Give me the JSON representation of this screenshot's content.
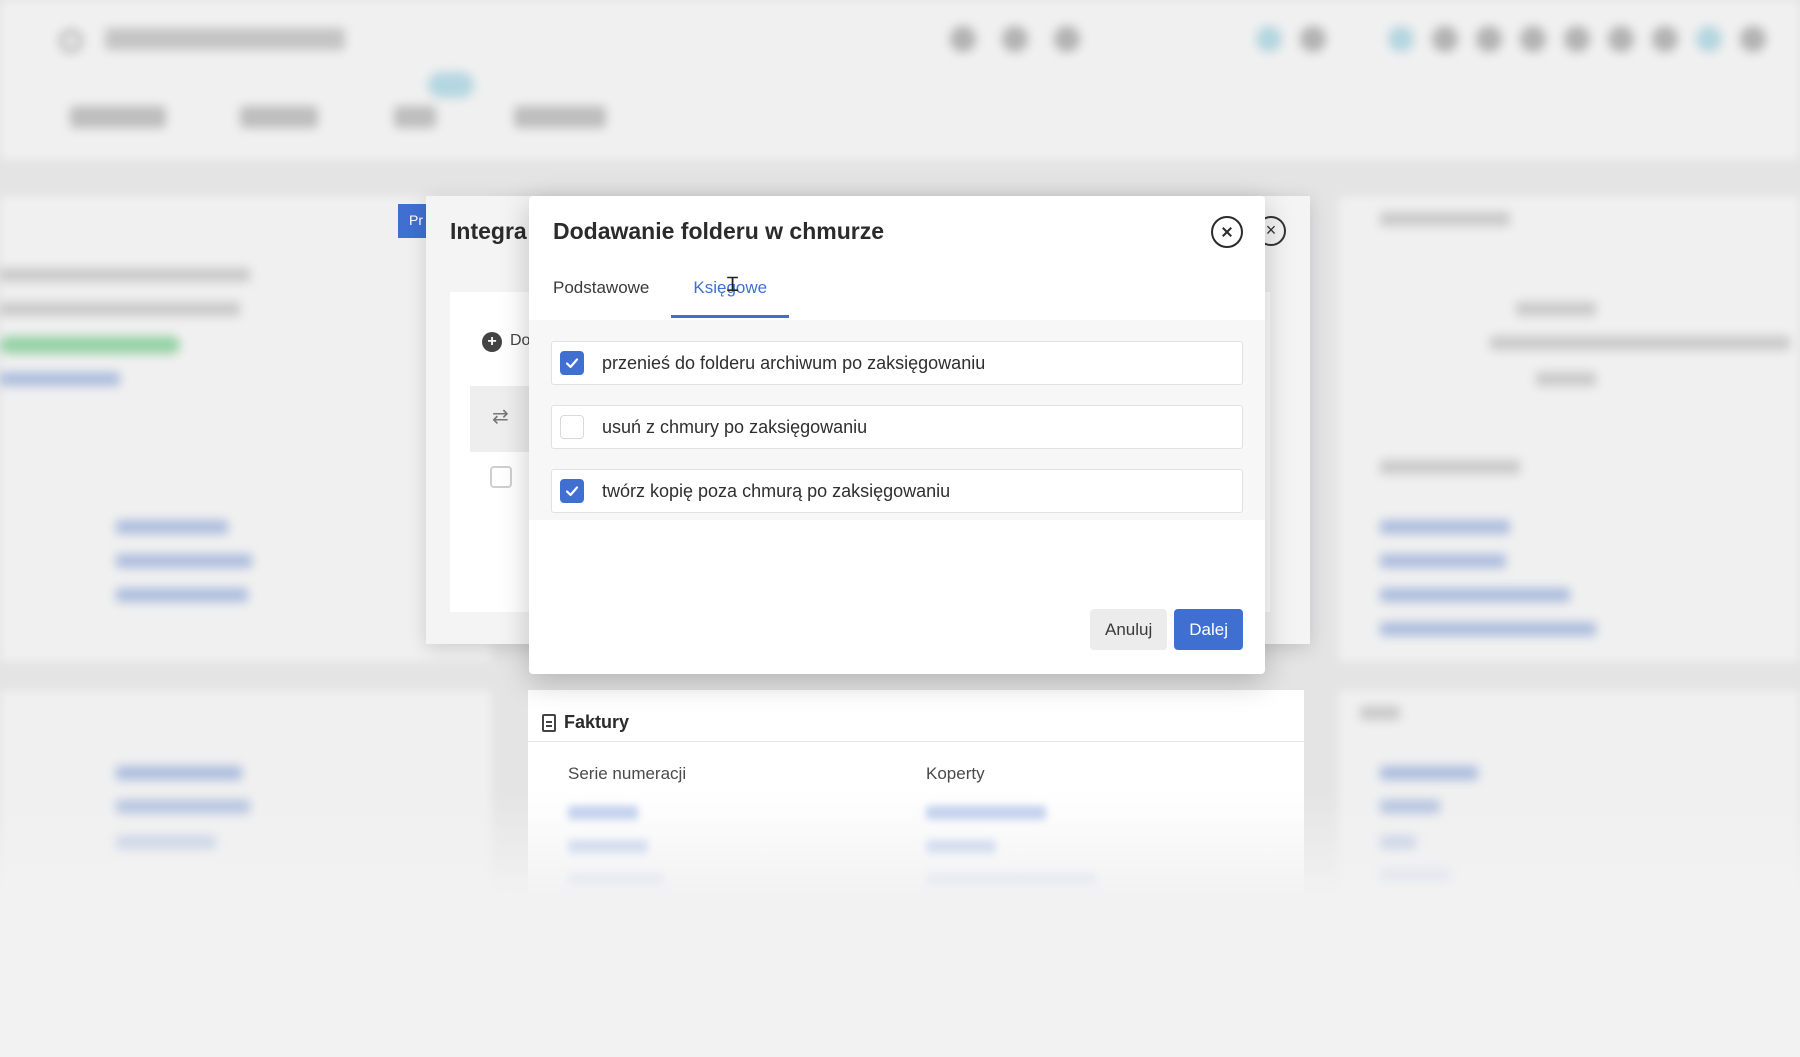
{
  "parent_dialog": {
    "title": "Integra",
    "badge": "Pr",
    "close_symbol": "×",
    "add_label": "Do",
    "add_icon": "plus-circle-icon",
    "sync_icon": "sync-icon"
  },
  "modal": {
    "title": "Dodawanie folderu w chmurze",
    "close_icon": "close-circle-icon",
    "tabs": [
      {
        "label": "Podstawowe",
        "active": false
      },
      {
        "label": "Księgowe",
        "active": true
      }
    ],
    "options": [
      {
        "label": "przenieś do folderu archiwum po zaksięgowaniu",
        "checked": true
      },
      {
        "label": "usuń z chmury po zaksięgowaniu",
        "checked": false
      },
      {
        "label": "twórz kopię poza chmurą po zaksięgowaniu",
        "checked": true
      }
    ],
    "cancel_label": "Anuluj",
    "next_label": "Dalej"
  },
  "faktury": {
    "title": "Faktury",
    "icon": "document-icon",
    "columns": [
      "Serie numeracji",
      "Koperty"
    ]
  },
  "colors": {
    "accent": "#3f6fd1",
    "checkbox_checked": "#3f6fd1",
    "dialog_bg": "#ffffff"
  }
}
